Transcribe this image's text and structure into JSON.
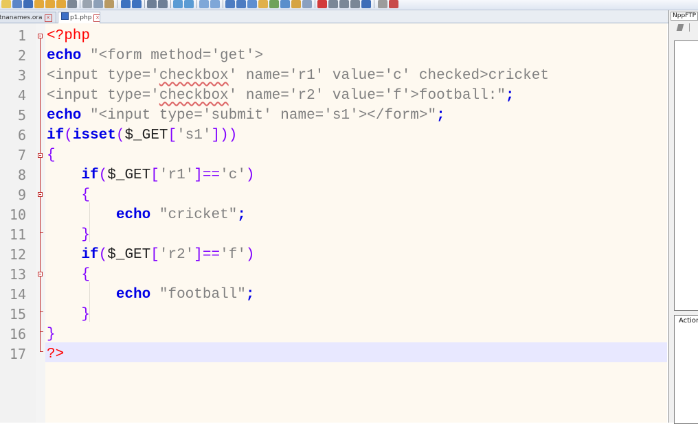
{
  "toolbar": {
    "icons": [
      "new-file-icon",
      "open-file-icon",
      "save-icon",
      "save-all-icon",
      "close-icon",
      "close-all-icon",
      "print-icon",
      "cut-icon",
      "copy-icon",
      "paste-icon",
      "undo-icon",
      "redo-icon",
      "find-icon",
      "replace-icon",
      "zoom-in-icon",
      "zoom-out-icon",
      "sync-vertical-icon",
      "sync-horizontal-icon",
      "word-wrap-icon",
      "show-all-chars-icon",
      "indent-guide-icon",
      "udl-icon",
      "doc-map-icon",
      "function-list-icon",
      "folder-workspace-icon",
      "monitoring-icon",
      "record-macro-icon",
      "stop-macro-icon",
      "play-macro-icon",
      "run-macro-multiple-icon",
      "save-macro-icon",
      "ftp-icon",
      "spellcheck-icon"
    ]
  },
  "tabs": [
    {
      "label": "tnanames.ora",
      "active": false
    },
    {
      "label": "p1.php",
      "active": true
    }
  ],
  "editor": {
    "lines": [
      {
        "n": "1"
      },
      {
        "n": "2"
      },
      {
        "n": "3"
      },
      {
        "n": "4"
      },
      {
        "n": "5"
      },
      {
        "n": "6"
      },
      {
        "n": "7"
      },
      {
        "n": "8"
      },
      {
        "n": "9"
      },
      {
        "n": "10"
      },
      {
        "n": "11"
      },
      {
        "n": "12"
      },
      {
        "n": "13"
      },
      {
        "n": "14"
      },
      {
        "n": "15"
      },
      {
        "n": "16"
      },
      {
        "n": "17"
      }
    ],
    "tokens": {
      "l1_open": "<?php",
      "l2_echo": "echo",
      "l2_str": "\"<form method='get'>",
      "l3_a": "<input type='",
      "l3_cb": "checkbox",
      "l3_b": "' name='r1' value='c' checked>cricket",
      "l4_a": "<input type='",
      "l4_cb": "checkbox",
      "l4_b": "' name='r2' value='f'>football:\"",
      "l4_semi": ";",
      "l5_echo": "echo",
      "l5_str": "\"<input type='submit' name='s1'></form>\"",
      "l5_semi": ";",
      "l6_if": "if",
      "l6_p1": "(",
      "l6_isset": "isset",
      "l6_p2": "(",
      "l6_var": "$_GET",
      "l6_b1": "[",
      "l6_key": "'s1'",
      "l6_b2": "]))",
      "l7_brace": "{",
      "l8_if": "if",
      "l8_p1": "(",
      "l8_var": "$_GET",
      "l8_b1": "[",
      "l8_key": "'r1'",
      "l8_b2": "]==",
      "l8_val": "'c'",
      "l8_p2": ")",
      "l9_brace": "{",
      "l10_echo": "echo",
      "l10_str": "\"cricket\"",
      "l10_semi": ";",
      "l11_brace": "}",
      "l12_if": "if",
      "l12_p1": "(",
      "l12_var": "$_GET",
      "l12_b1": "[",
      "l12_key": "'r2'",
      "l12_b2": "]==",
      "l12_val": "'f'",
      "l12_p2": ")",
      "l13_brace": "{",
      "l14_echo": "echo",
      "l14_str": "\"football\"",
      "l14_semi": ";",
      "l15_brace": "}",
      "l16_brace": "}",
      "l17_close": "?>"
    }
  },
  "panel": {
    "title": "NppFTP",
    "section_label": "Action"
  },
  "colors": {
    "keyword": "#0000e6",
    "string": "#808080",
    "php_tag": "#ff0000",
    "operator": "#8000ff",
    "current_line": "#e8e8ff",
    "fold_marker": "#c02a2a"
  }
}
